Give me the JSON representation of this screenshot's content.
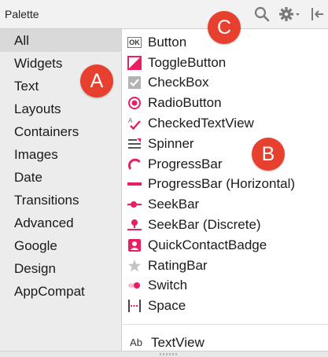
{
  "title": "Palette",
  "categories": [
    "All",
    "Widgets",
    "Text",
    "Layouts",
    "Containers",
    "Images",
    "Date",
    "Transitions",
    "Advanced",
    "Google",
    "Design",
    "AppCompat"
  ],
  "selected_category": "All",
  "widgets": [
    {
      "label": "Button",
      "icon": "ok-button-icon"
    },
    {
      "label": "ToggleButton",
      "icon": "toggle-button-icon"
    },
    {
      "label": "CheckBox",
      "icon": "checkbox-icon"
    },
    {
      "label": "RadioButton",
      "icon": "radio-button-icon"
    },
    {
      "label": "CheckedTextView",
      "icon": "checked-text-view-icon"
    },
    {
      "label": "Spinner",
      "icon": "spinner-icon"
    },
    {
      "label": "ProgressBar",
      "icon": "progress-bar-icon"
    },
    {
      "label": "ProgressBar (Horizontal)",
      "icon": "progress-bar-horizontal-icon"
    },
    {
      "label": "SeekBar",
      "icon": "seekbar-icon"
    },
    {
      "label": "SeekBar (Discrete)",
      "icon": "seekbar-discrete-icon"
    },
    {
      "label": "QuickContactBadge",
      "icon": "quick-contact-badge-icon"
    },
    {
      "label": "RatingBar",
      "icon": "rating-bar-icon"
    },
    {
      "label": "Switch",
      "icon": "switch-icon"
    },
    {
      "label": "Space",
      "icon": "space-icon"
    }
  ],
  "textview": {
    "label": "TextView",
    "icon_text": "Ab"
  },
  "button_icon_text": "OK",
  "badges": {
    "a": "A",
    "b": "B",
    "c": "C"
  },
  "colors": {
    "accent": "#e91e63",
    "badge": "#e8402f",
    "icon_gray": "#8c8c8c"
  }
}
